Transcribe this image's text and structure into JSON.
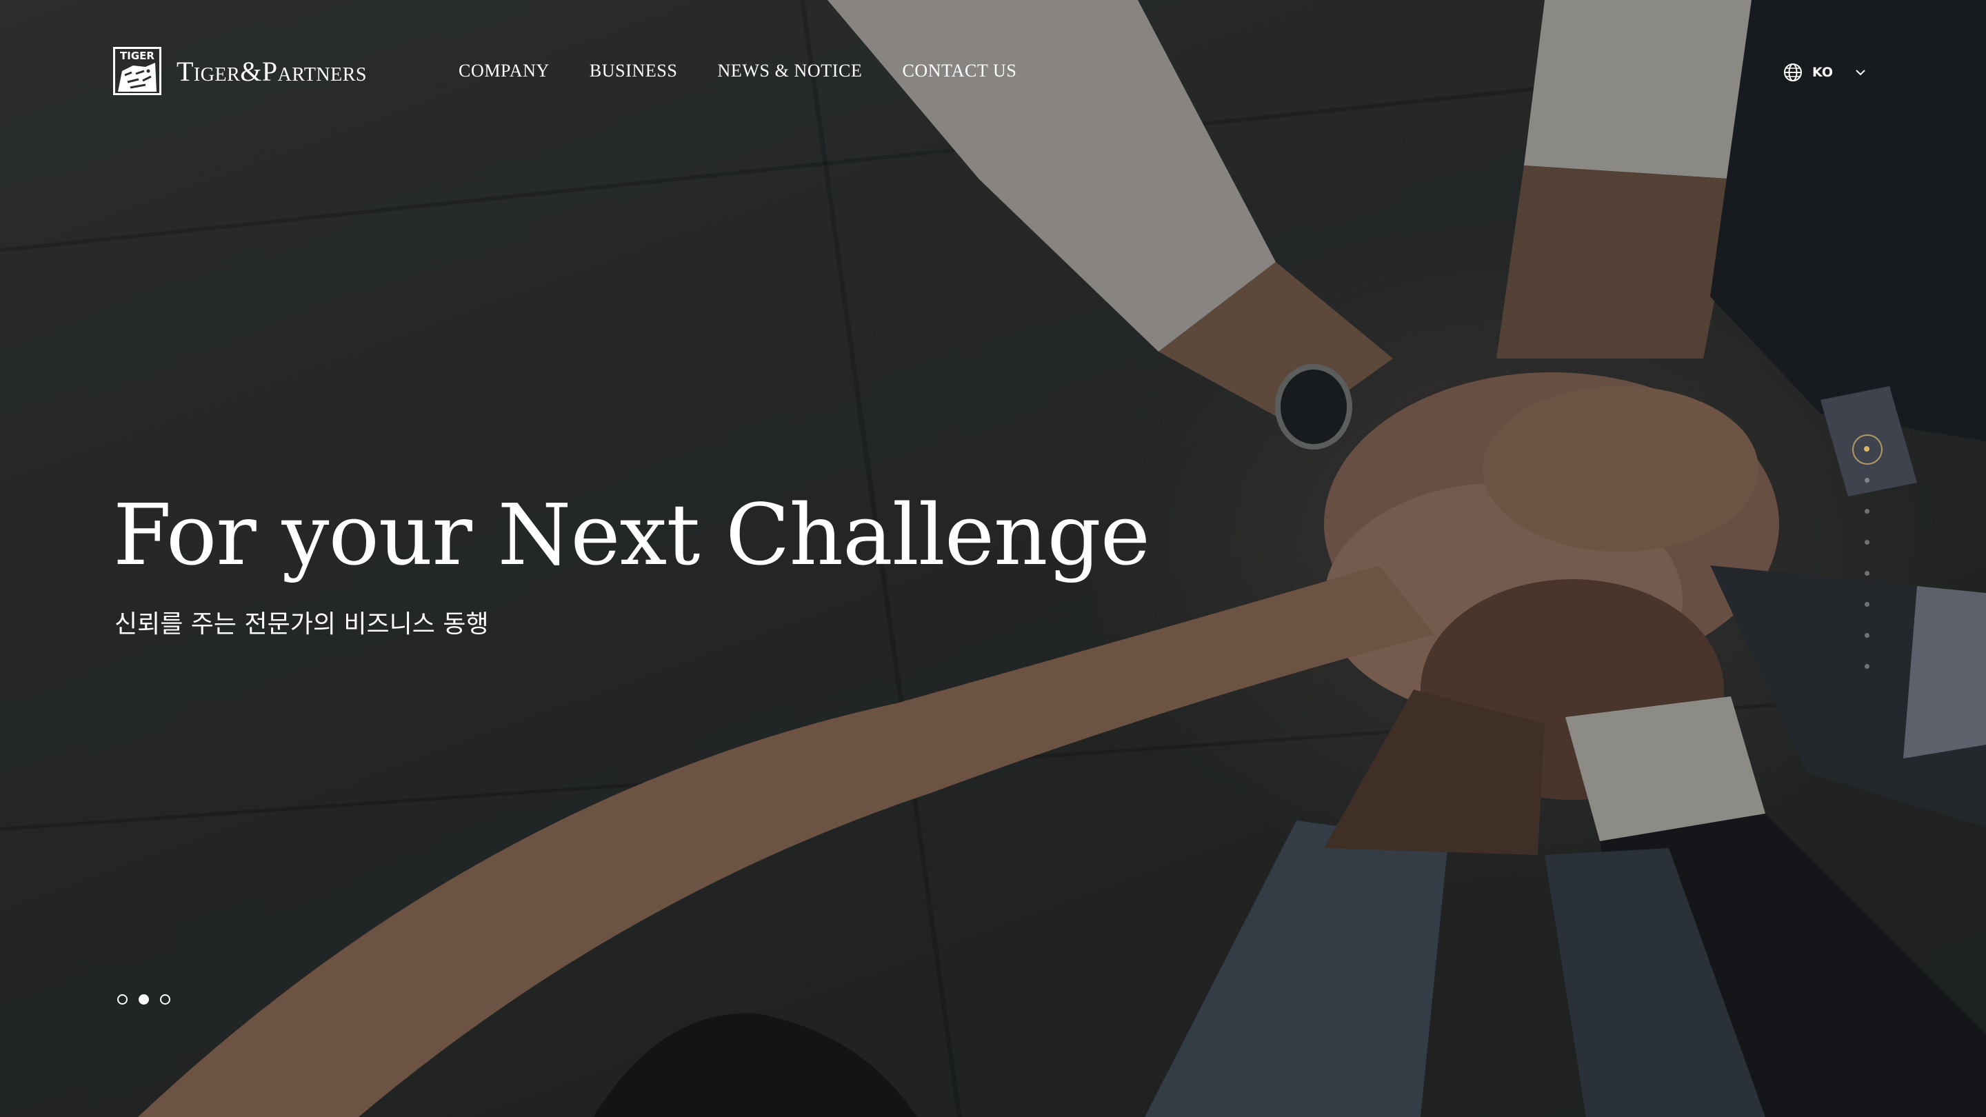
{
  "header": {
    "logo_mark_text": "TIGER",
    "logo_text": "Tiger&Partners",
    "nav": [
      {
        "label": "COMPANY"
      },
      {
        "label": "BUSINESS"
      },
      {
        "label": "NEWS & NOTICE"
      },
      {
        "label": "CONTACT US"
      }
    ],
    "language": {
      "label": "KO",
      "icon": "globe-icon",
      "chevron": "chevron-down-icon"
    }
  },
  "hero": {
    "title": "For your Next Challenge",
    "subtitle": "신뢰를 주는 전문가의 비즈니스 동행"
  },
  "slider": {
    "total": 3,
    "active_index": 1
  },
  "section_nav": {
    "total": 8,
    "active_index": 0
  },
  "colors": {
    "accent": "#d9b46a",
    "ring": "#b39a64",
    "text": "#ffffff"
  }
}
